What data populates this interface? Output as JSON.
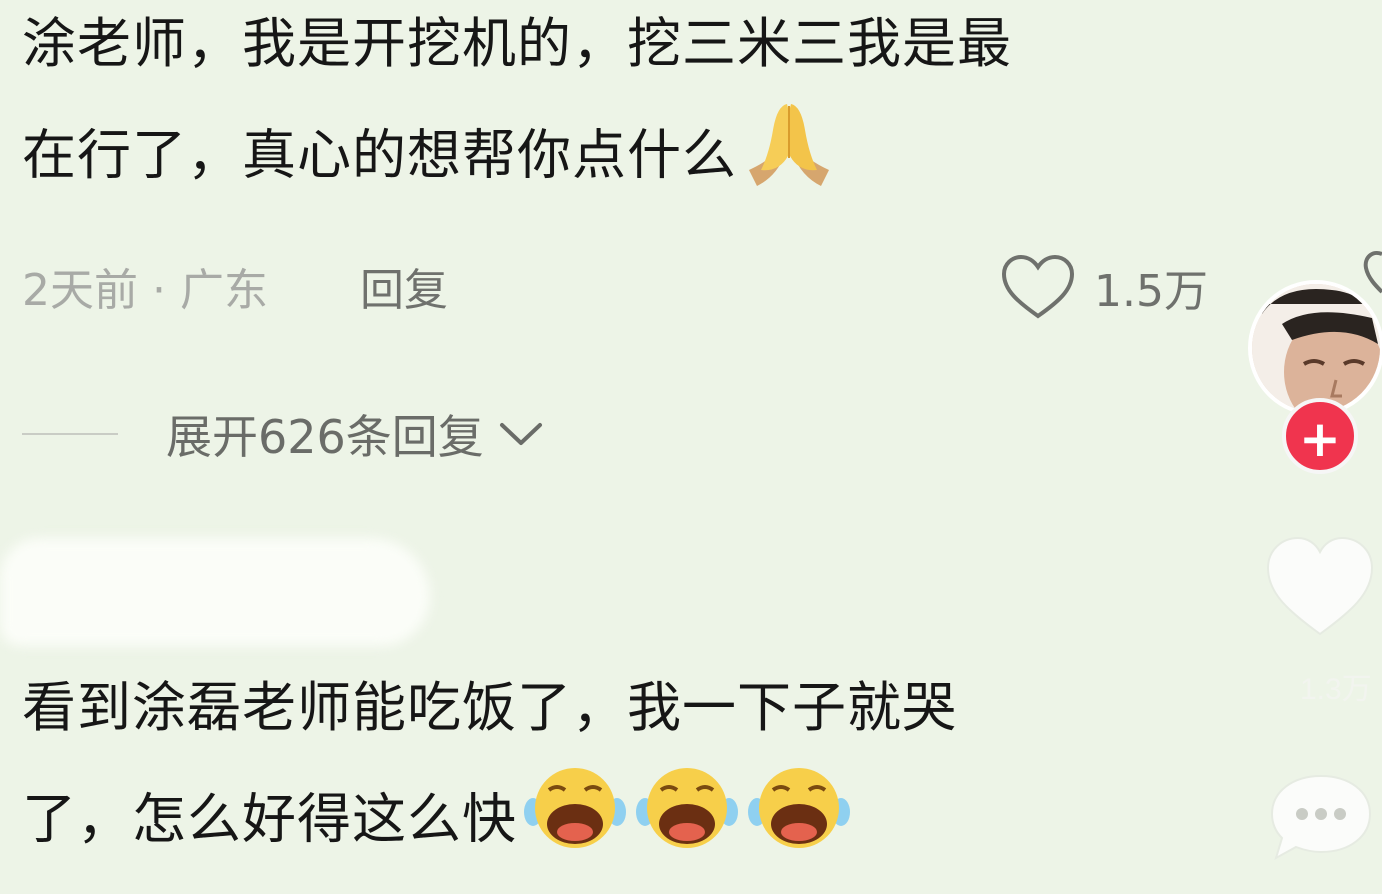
{
  "comments": [
    {
      "lines": [
        "涂老师，我是开挖机的，挖三米三我是最",
        "在行了，真心的想帮你点什么"
      ],
      "emoji_icon": "folded-hands-icon",
      "time_location": "2天前 · 广东",
      "reply_label": "回复",
      "like_count": "1.5万",
      "expand_label": "展开626条回复"
    },
    {
      "lines": [
        "看到涂磊老师能吃饭了，我一下子就哭",
        "了，怎么好得这么快"
      ],
      "emoji_icons": [
        "crying-face-icon",
        "crying-face-icon",
        "crying-face-icon"
      ]
    }
  ],
  "side_rail": {
    "follow_label": "+",
    "like_count": "1.3万"
  },
  "colors": {
    "background": "#edf4e7",
    "follow_red": "#f0344e",
    "meta_gray": "#a8aaa6"
  }
}
